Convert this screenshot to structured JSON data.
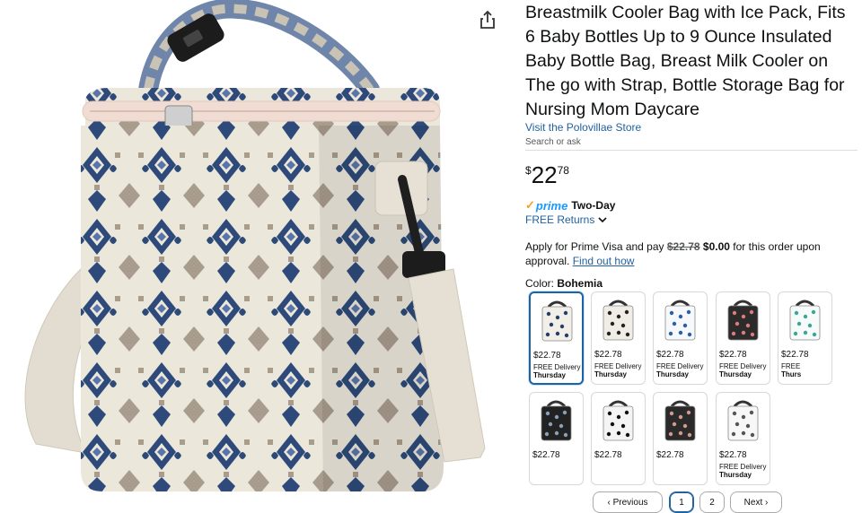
{
  "product": {
    "title": "Breastmilk Cooler Bag with Ice Pack, Fits 6 Baby Bottles Up to 9 Ounce Insulated Baby Bottle Bag, Breast Milk Cooler on The go with Strap, Bottle Storage Bag for Nursing Mom Daycare",
    "store_link": "Visit the Polovillae Store",
    "search_ask": "Search or ask",
    "price": {
      "symbol": "$",
      "whole": "22",
      "fraction": "78"
    },
    "prime_text": "prime",
    "prime_badge": "Two-Day",
    "returns": "FREE Returns",
    "visa": {
      "prefix": "Apply for Prime Visa and pay ",
      "strike": "$22.78",
      "zero": "$0.00",
      "suffix": " for this order upon approval. ",
      "link": "Find out how"
    },
    "color_label": "Color:",
    "color_value": "Bohemia"
  },
  "swatches": [
    {
      "price": "$22.78",
      "delivery": "FREE Delivery",
      "day": "Thursday",
      "selected": true,
      "bag": "#f2efe9",
      "dots": "#243d6a"
    },
    {
      "price": "$22.78",
      "delivery": "FREE Delivery",
      "day": "Thursday",
      "bag": "#f0ede6",
      "dots": "#222222"
    },
    {
      "price": "$22.78",
      "delivery": "FREE Delivery",
      "day": "Thursday",
      "bag": "#f6f8fb",
      "dots": "#2b5fa8"
    },
    {
      "price": "$22.78",
      "delivery": "FREE Delivery",
      "day": "Thursday",
      "bag": "#2b2b2b",
      "dots": "#e07b7b"
    },
    {
      "price": "$22.78",
      "delivery": "FREE",
      "day": "Thurs",
      "bag": "#f6faf9",
      "dots": "#3aa59a"
    },
    {
      "price": "$22.78",
      "delivery": "",
      "day": "",
      "bag": "#222222",
      "dots": "#8aa0b8"
    },
    {
      "price": "$22.78",
      "delivery": "",
      "day": "",
      "bag": "#f4f4f4",
      "dots": "#111111"
    },
    {
      "price": "$22.78",
      "delivery": "",
      "day": "",
      "bag": "#2a2a2a",
      "dots": "#d49a8a"
    },
    {
      "price": "$22.78",
      "delivery": "FREE Delivery",
      "day": "Thursday",
      "bag": "#f7f7f7",
      "dots": "#555555"
    }
  ],
  "pagination": {
    "prev": "‹ Previous",
    "pages": [
      "1",
      "2"
    ],
    "next": "Next ›"
  },
  "icons": {
    "share": "share-icon",
    "chevron": "chevron-down-icon"
  },
  "colors": {
    "link": "#2162a1",
    "prime": "#1a98ff",
    "check": "#f7a11a",
    "pattern_blue": "#2e4a7a",
    "pattern_tan": "#a89c8c"
  }
}
